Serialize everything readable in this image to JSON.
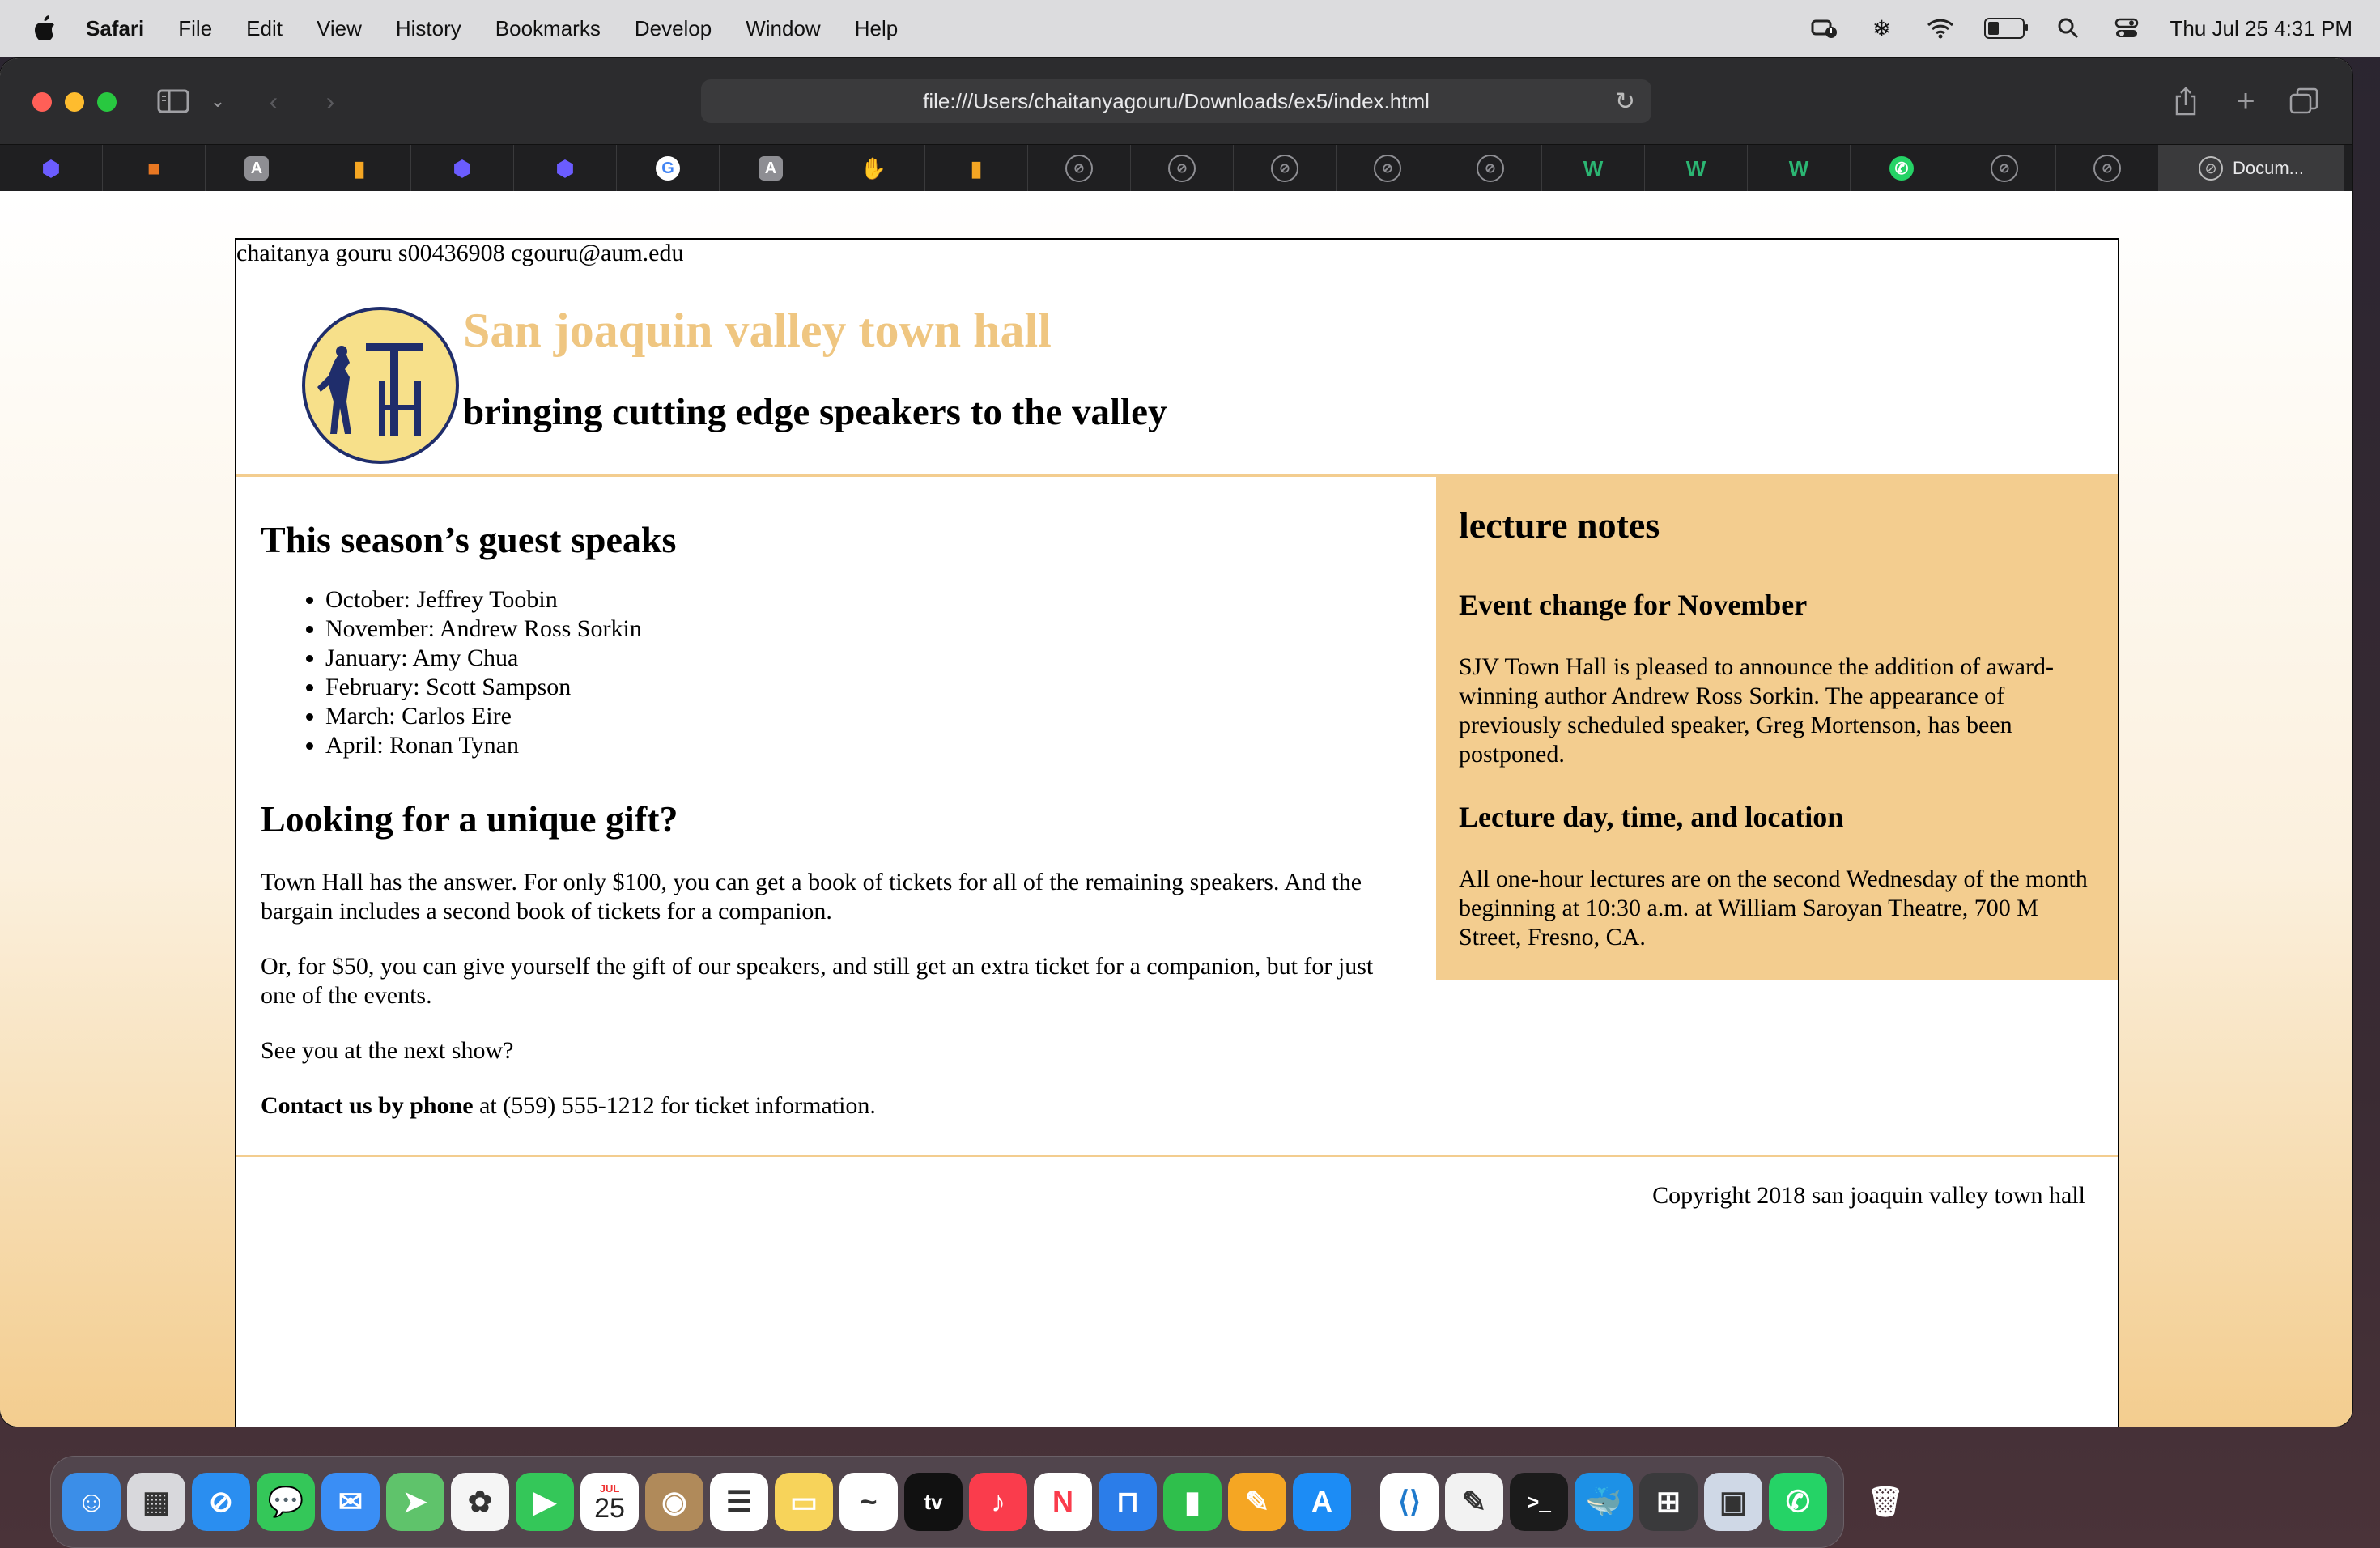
{
  "menubar": {
    "app_name": "Safari",
    "items": [
      "File",
      "Edit",
      "View",
      "History",
      "Bookmarks",
      "Develop",
      "Window",
      "Help"
    ],
    "datetime": "Thu Jul 25  4:31 PM"
  },
  "browser": {
    "url": "file:///Users/chaitanyagouru/Downloads/ex5/index.html",
    "active_tab_title": "Docum..."
  },
  "tabs": [
    {
      "icon": "cube-icon",
      "color": "#6b5cff"
    },
    {
      "icon": "box-icon",
      "color": "#e87722"
    },
    {
      "icon": "letter-a-icon",
      "color": "#8e8e93"
    },
    {
      "icon": "bar-chart-icon",
      "color": "#f5a623"
    },
    {
      "icon": "cube-icon",
      "color": "#6b5cff"
    },
    {
      "icon": "cube-icon",
      "color": "#6b5cff"
    },
    {
      "icon": "google-icon",
      "color": "#ffffff"
    },
    {
      "icon": "letter-a-icon",
      "color": "#8e8e93"
    },
    {
      "icon": "hand-icon",
      "color": "#f2a07b"
    },
    {
      "icon": "bar-chart-icon",
      "color": "#f5a623"
    },
    {
      "icon": "compass-icon",
      "color": "#8e8e93"
    },
    {
      "icon": "compass-icon",
      "color": "#8e8e93"
    },
    {
      "icon": "compass-icon",
      "color": "#8e8e93"
    },
    {
      "icon": "compass-icon",
      "color": "#8e8e93"
    },
    {
      "icon": "compass-icon",
      "color": "#8e8e93"
    },
    {
      "icon": "w-icon",
      "color": "#2bb673"
    },
    {
      "icon": "w-icon",
      "color": "#2bb673"
    },
    {
      "icon": "w-icon",
      "color": "#2bb673"
    },
    {
      "icon": "whatsapp-icon",
      "color": "#25d366"
    },
    {
      "icon": "compass-icon",
      "color": "#8e8e93"
    },
    {
      "icon": "compass-icon",
      "color": "#8e8e93"
    }
  ],
  "page": {
    "student_line": "chaitanya gouru s00436908 cgouru@aum.edu",
    "site_title": "San joaquin valley town hall",
    "tagline": "bringing cutting edge speakers to the valley",
    "main": {
      "speakers_heading": "This season’s guest speaks",
      "speakers": [
        "October: Jeffrey Toobin",
        "November: Andrew Ross Sorkin",
        "January: Amy Chua",
        "February: Scott Sampson",
        "March: Carlos Eire",
        "April: Ronan Tynan"
      ],
      "gift_heading": "Looking for a unique gift?",
      "gift_p1": "Town Hall has the answer. For only $100, you can get a book of tickets for all of the remaining speakers. And the bargain includes a second book of tickets for a companion.",
      "gift_p2": "Or, for $50, you can give yourself the gift of our speakers, and still get an extra ticket for a companion, but for just one of the events.",
      "gift_p3": "See you at the next show?",
      "contact_bold": "Contact us by phone",
      "contact_rest": " at (559) 555-1212 for ticket information."
    },
    "aside": {
      "heading": "lecture notes",
      "event_heading": "Event change for November",
      "event_text": "SJV Town Hall is pleased to announce the addition of award-winning author Andrew Ross Sorkin. The appearance of previously scheduled speaker, Greg Mortenson, has been postponed.",
      "lecture_heading": "Lecture day, time, and location",
      "lecture_text": "All one-hour lectures are on the second Wednesday of the month beginning at 10:30 a.m. at William Saroyan Theatre, 700 M Street, Fresno, CA."
    },
    "footer": "Copyright 2018 san joaquin valley town hall",
    "colors": {
      "accent": "#f3cd8f",
      "title": "#efc681"
    }
  },
  "dock": {
    "calendar_month": "JUL",
    "calendar_day": "25",
    "apps": [
      "finder-icon",
      "launchpad-icon",
      "safari-icon",
      "messages-icon",
      "mail-icon",
      "maps-icon",
      "photos-icon",
      "facetime-icon",
      "calendar-icon",
      "contacts-icon",
      "reminders-icon",
      "notes-icon",
      "freeform-icon",
      "tv-icon",
      "music-icon",
      "news-icon",
      "keynote-icon",
      "numbers-icon",
      "pages-icon",
      "app-store-icon",
      "vscode-icon",
      "textedit-icon",
      "terminal-icon",
      "docker-icon",
      "calculator-icon",
      "preview-icon",
      "whatsapp-icon",
      "trash-icon"
    ]
  }
}
